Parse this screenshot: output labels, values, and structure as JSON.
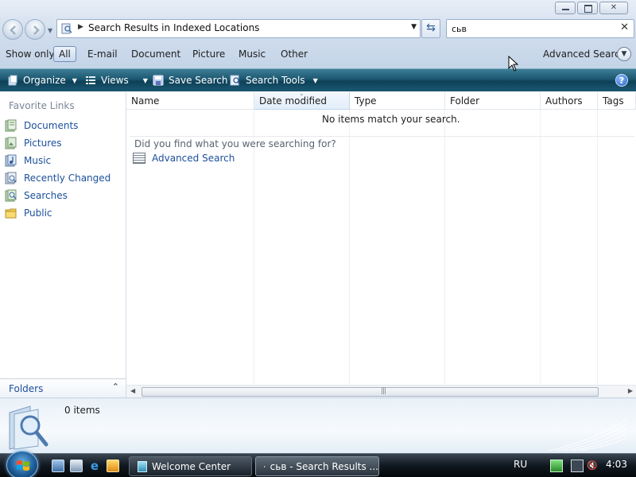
{
  "address": {
    "path": "Search Results in Indexed Locations"
  },
  "search": {
    "query": "сьв"
  },
  "filter_bar": {
    "label": "Show only:",
    "filters": [
      "All",
      "E-mail",
      "Document",
      "Picture",
      "Music",
      "Other"
    ],
    "active": "All",
    "advanced": "Advanced Search"
  },
  "toolbar": {
    "organize": "Organize",
    "views": "Views",
    "save_search": "Save Search",
    "search_tools": "Search Tools"
  },
  "nav": {
    "title": "Favorite Links",
    "items": [
      "Documents",
      "Pictures",
      "Music",
      "Recently Changed",
      "Searches",
      "Public"
    ],
    "folders": "Folders"
  },
  "columns": [
    "Name",
    "Date modified",
    "Type",
    "Folder",
    "Authors",
    "Tags"
  ],
  "content": {
    "empty_message": "No items match your search.",
    "prompt": "Did you find what you were searching for?",
    "advanced_link": "Advanced Search"
  },
  "details": {
    "count": "0 items"
  },
  "taskbar": {
    "tasks": [
      "Welcome Center",
      "сьв - Search Results ..."
    ],
    "language": "RU",
    "clock": "4:03"
  },
  "colors": {
    "link": "#1b4f9c",
    "toolbar": "#1c5770",
    "taskbar": "#101820"
  }
}
